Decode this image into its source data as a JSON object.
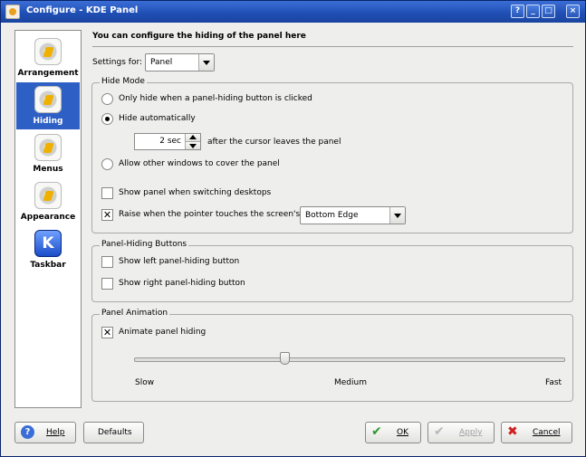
{
  "window": {
    "title": "Configure - KDE Panel"
  },
  "title_buttons": [
    "?",
    "_",
    "□",
    "×"
  ],
  "sidebar": {
    "items": [
      {
        "label": "Arrangement",
        "icon": "gear-icon"
      },
      {
        "label": "Hiding",
        "icon": "gear-icon",
        "selected": true
      },
      {
        "label": "Menus",
        "icon": "gear-icon"
      },
      {
        "label": "Appearance",
        "icon": "gear-icon"
      },
      {
        "label": "Taskbar",
        "icon": "kde-icon",
        "glyph": "K"
      }
    ]
  },
  "main": {
    "heading": "You can configure the hiding of the panel here",
    "settings_for_label": "Settings for:",
    "settings_for_value": "Panel",
    "hide_mode": {
      "title": "Hide Mode",
      "option_button_only": "Only hide when a panel-hiding button is clicked",
      "option_auto": "Hide automatically",
      "delay_value": "2 sec",
      "delay_suffix": "after the cursor leaves the panel",
      "option_allow_cover": "Allow other windows to cover the panel",
      "show_switching_label": "Show panel when switching desktops",
      "raise_label": "Raise when the pointer touches the screen's:",
      "raise_value": "Bottom Edge",
      "check_mark": "✕"
    },
    "panel_hiding_buttons": {
      "title": "Panel-Hiding Buttons",
      "show_left": "Show left panel-hiding button",
      "show_right": "Show right panel-hiding button"
    },
    "panel_animation": {
      "title": "Panel Animation",
      "animate_label": "Animate panel hiding",
      "slider_slow": "Slow",
      "slider_medium": "Medium",
      "slider_fast": "Fast",
      "speed_level": 0.35
    }
  },
  "footer": {
    "help": "Help",
    "defaults": "Defaults",
    "ok": "OK",
    "apply": "Apply",
    "cancel": "Cancel",
    "help_glyph": "?",
    "ok_glyph": "✔",
    "apply_glyph": "✔",
    "cancel_glyph": "✖"
  },
  "colors": {
    "accent": "#2e5fc4",
    "titlebar": "#1f4eb3"
  }
}
